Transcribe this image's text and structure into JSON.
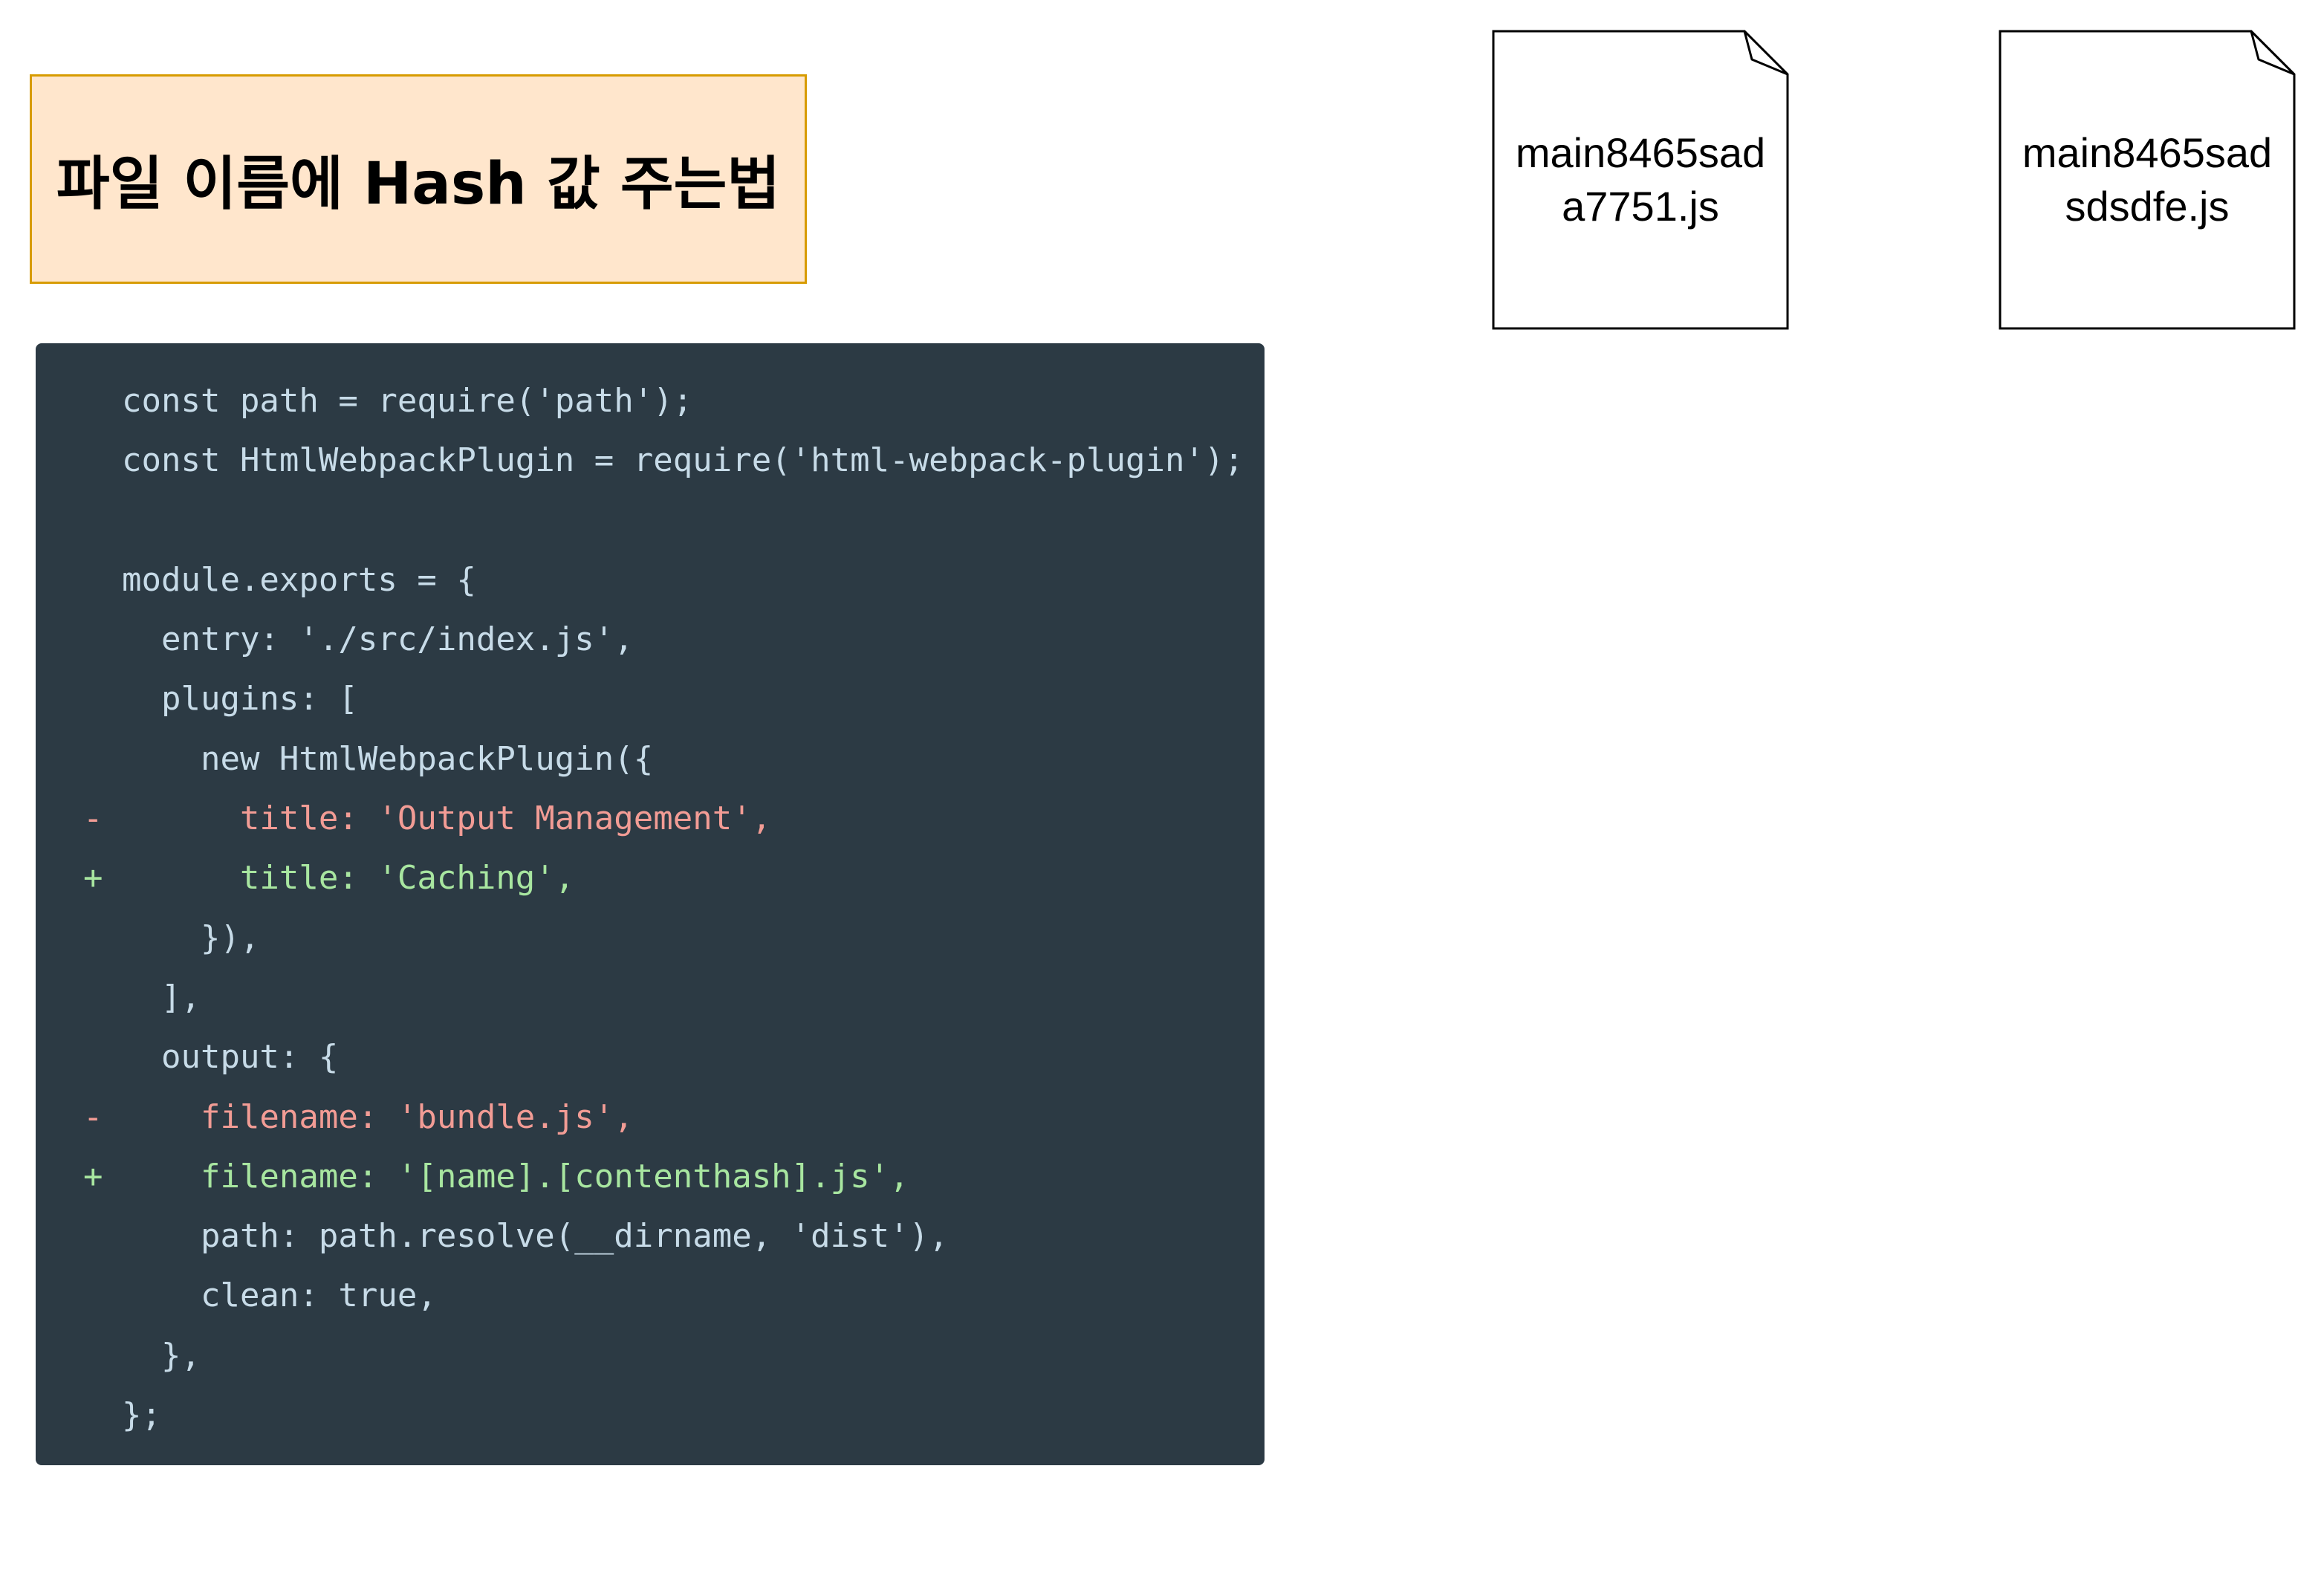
{
  "title": "파일 이름에 Hash 값 주는법",
  "code": [
    {
      "marker": "",
      "text": "const path = require('path');",
      "kind": "normal"
    },
    {
      "marker": "",
      "text": "const HtmlWebpackPlugin = require('html-webpack-plugin');",
      "kind": "normal"
    },
    {
      "marker": "",
      "text": "",
      "kind": "normal"
    },
    {
      "marker": "",
      "text": "module.exports = {",
      "kind": "normal"
    },
    {
      "marker": "",
      "text": "  entry: './src/index.js',",
      "kind": "normal"
    },
    {
      "marker": "",
      "text": "  plugins: [",
      "kind": "normal"
    },
    {
      "marker": "",
      "text": "    new HtmlWebpackPlugin({",
      "kind": "normal"
    },
    {
      "marker": "-",
      "text": "      title: 'Output Management',",
      "kind": "removed"
    },
    {
      "marker": "+",
      "text": "      title: 'Caching',",
      "kind": "added"
    },
    {
      "marker": "",
      "text": "    }),",
      "kind": "normal"
    },
    {
      "marker": "",
      "text": "  ],",
      "kind": "normal"
    },
    {
      "marker": "",
      "text": "  output: {",
      "kind": "normal"
    },
    {
      "marker": "-",
      "text": "    filename: 'bundle.js',",
      "kind": "removed"
    },
    {
      "marker": "+",
      "text": "    filename: '[name].[contenthash].js',",
      "kind": "added"
    },
    {
      "marker": "",
      "text": "    path: path.resolve(__dirname, 'dist'),",
      "kind": "normal"
    },
    {
      "marker": "",
      "text": "    clean: true,",
      "kind": "normal"
    },
    {
      "marker": "",
      "text": "  },",
      "kind": "normal"
    },
    {
      "marker": "",
      "text": "};",
      "kind": "normal"
    }
  ],
  "files": [
    {
      "line1": "main8465sad",
      "line2": "a7751.js"
    },
    {
      "line1": "main8465sad",
      "line2": "sdsdfe.js"
    }
  ],
  "colors": {
    "title_fill": "#ffe6cc",
    "title_border": "#d79b00",
    "code_background": "#2c3a44",
    "code_text": "#c7dbe8",
    "removed_text": "#f29c95",
    "added_text": "#a8e6a0"
  }
}
